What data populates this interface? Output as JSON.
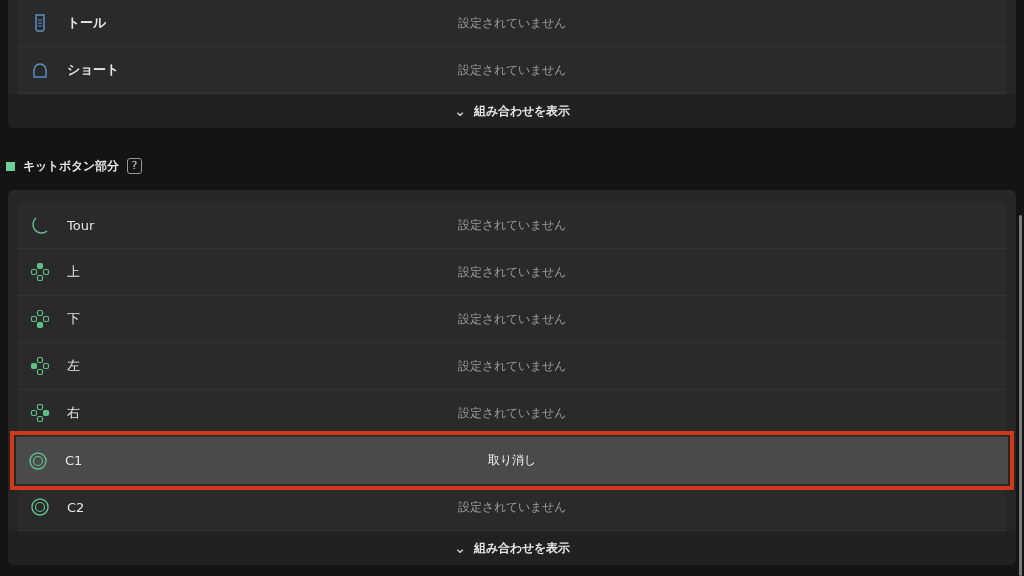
{
  "panels": [
    {
      "rows": [
        {
          "kind": "tall",
          "label": "トール",
          "value": "設定されていません",
          "selected": false
        },
        {
          "kind": "short",
          "label": "ショート",
          "value": "設定されていません",
          "selected": false
        }
      ],
      "footer": {
        "caret": "⌄",
        "label": "組み合わせを表示"
      }
    },
    {
      "heading": {
        "label": "キットボタン部分",
        "help": "?"
      },
      "rows": [
        {
          "kind": "tour",
          "label": "Tour",
          "value": "設定されていません",
          "selected": false
        },
        {
          "kind": "dpad-up",
          "label": "上",
          "value": "設定されていません",
          "selected": false
        },
        {
          "kind": "dpad-down",
          "label": "下",
          "value": "設定されていません",
          "selected": false
        },
        {
          "kind": "dpad-left",
          "label": "左",
          "value": "設定されていません",
          "selected": false
        },
        {
          "kind": "dpad-right",
          "label": "右",
          "value": "設定されていません",
          "selected": false
        },
        {
          "kind": "circle",
          "label": "C1",
          "value": "取り消し",
          "selected": true
        },
        {
          "kind": "circle",
          "label": "C2",
          "value": "設定されていません",
          "selected": false
        }
      ],
      "footer": {
        "caret": "⌄",
        "label": "組み合わせを表示"
      }
    }
  ]
}
